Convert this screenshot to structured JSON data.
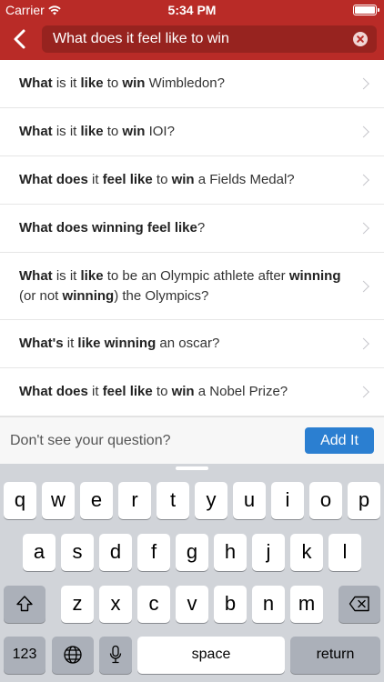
{
  "status_bar": {
    "carrier": "Carrier",
    "time": "5:34 PM"
  },
  "search": {
    "query": "What does it feel like to win"
  },
  "results": [
    {
      "segments": [
        {
          "t": "What",
          "b": true
        },
        {
          "t": " is it ",
          "b": false
        },
        {
          "t": "like",
          "b": true
        },
        {
          "t": " to ",
          "b": false
        },
        {
          "t": "win",
          "b": true
        },
        {
          "t": " Wimbledon?",
          "b": false
        }
      ]
    },
    {
      "segments": [
        {
          "t": "What",
          "b": true
        },
        {
          "t": " is it ",
          "b": false
        },
        {
          "t": "like",
          "b": true
        },
        {
          "t": " to ",
          "b": false
        },
        {
          "t": "win",
          "b": true
        },
        {
          "t": " IOI?",
          "b": false
        }
      ]
    },
    {
      "segments": [
        {
          "t": "What does",
          "b": true
        },
        {
          "t": " it ",
          "b": false
        },
        {
          "t": "feel like",
          "b": true
        },
        {
          "t": " to ",
          "b": false
        },
        {
          "t": "win",
          "b": true
        },
        {
          "t": " a Fields Medal?",
          "b": false
        }
      ]
    },
    {
      "segments": [
        {
          "t": "What does winning feel like",
          "b": true
        },
        {
          "t": "?",
          "b": false
        }
      ]
    },
    {
      "segments": [
        {
          "t": "What",
          "b": true
        },
        {
          "t": " is it ",
          "b": false
        },
        {
          "t": "like",
          "b": true
        },
        {
          "t": " to be an Olympic athlete after ",
          "b": false
        },
        {
          "t": "winning",
          "b": true
        },
        {
          "t": " (or not ",
          "b": false
        },
        {
          "t": "winning",
          "b": true
        },
        {
          "t": ") the Olympics?",
          "b": false
        }
      ]
    },
    {
      "segments": [
        {
          "t": "What's",
          "b": true
        },
        {
          "t": " it ",
          "b": false
        },
        {
          "t": "like winning",
          "b": true
        },
        {
          "t": " an oscar?",
          "b": false
        }
      ]
    },
    {
      "segments": [
        {
          "t": "What does",
          "b": true
        },
        {
          "t": " it ",
          "b": false
        },
        {
          "t": "feel like",
          "b": true
        },
        {
          "t": " to ",
          "b": false
        },
        {
          "t": "win",
          "b": true
        },
        {
          "t": " a Nobel Prize?",
          "b": false
        }
      ]
    }
  ],
  "footer": {
    "prompt": "Don't see your question?",
    "button": "Add It"
  },
  "keyboard": {
    "row1": [
      "q",
      "w",
      "e",
      "r",
      "t",
      "y",
      "u",
      "i",
      "o",
      "p"
    ],
    "row2": [
      "a",
      "s",
      "d",
      "f",
      "g",
      "h",
      "j",
      "k",
      "l"
    ],
    "row3": [
      "z",
      "x",
      "c",
      "v",
      "b",
      "n",
      "m"
    ],
    "numbers_key": "123",
    "space_key": "space",
    "return_key": "return"
  },
  "colors": {
    "header": "#b92b27",
    "add_button": "#2b7fd1"
  },
  "icons": [
    "wifi-icon",
    "battery-icon",
    "back-chevron-icon",
    "clear-search-icon",
    "row-chevron-icon",
    "shift-icon",
    "backspace-icon",
    "globe-icon",
    "microphone-icon"
  ]
}
